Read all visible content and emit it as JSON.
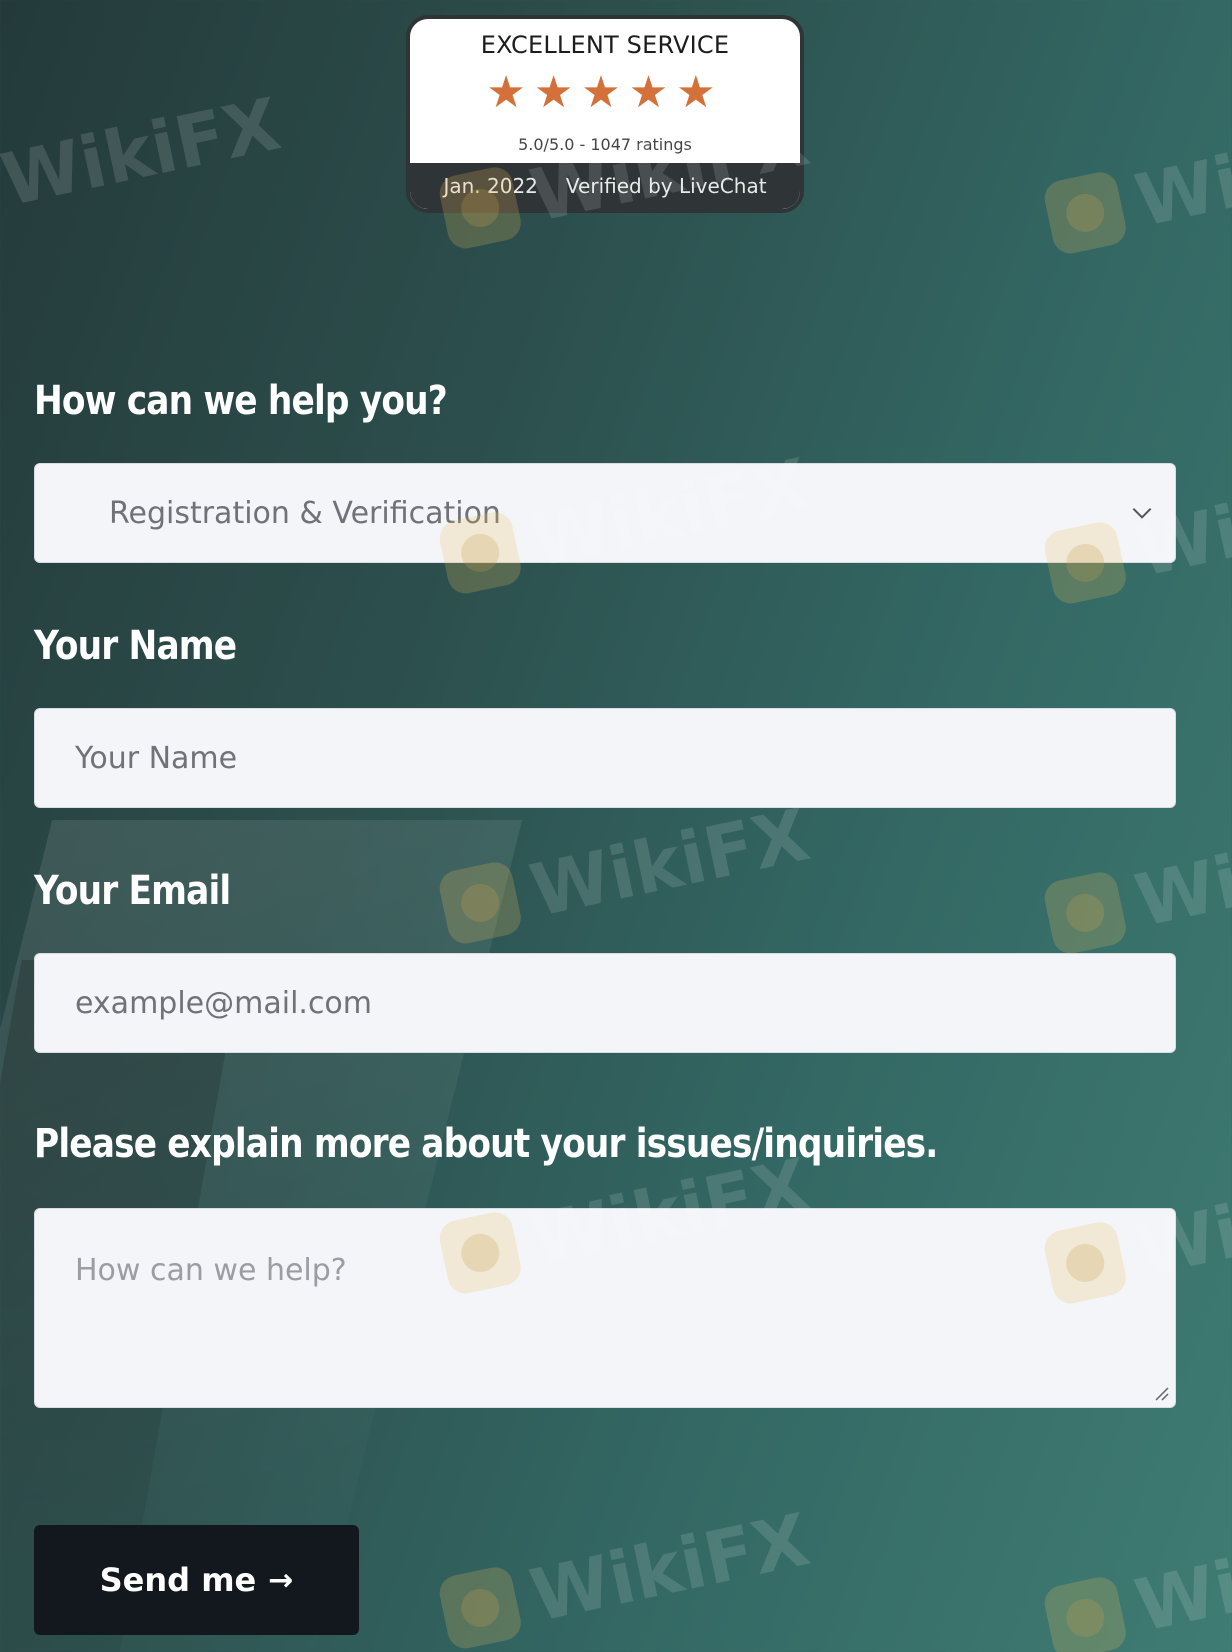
{
  "badge": {
    "title": "EXCELLENT SERVICE",
    "stars": [
      "★",
      "★",
      "★",
      "★",
      "★"
    ],
    "rating_text": "5.0/5.0 - 1047 ratings",
    "date": "Jan. 2022",
    "verified": "Verified by LiveChat",
    "star_color": "#d4703a"
  },
  "form": {
    "help_label": "How can we help you?",
    "help_select_value": "Registration & Verification",
    "name_label": "Your Name",
    "name_placeholder": "Your Name",
    "email_label": "Your Email",
    "email_placeholder": "example@mail.com",
    "message_label": "Please explain more about your issues/inquiries.",
    "message_placeholder": "How can we help?",
    "submit_label": "Send me",
    "submit_arrow": "→"
  },
  "watermark": {
    "text": "WikiFX"
  }
}
